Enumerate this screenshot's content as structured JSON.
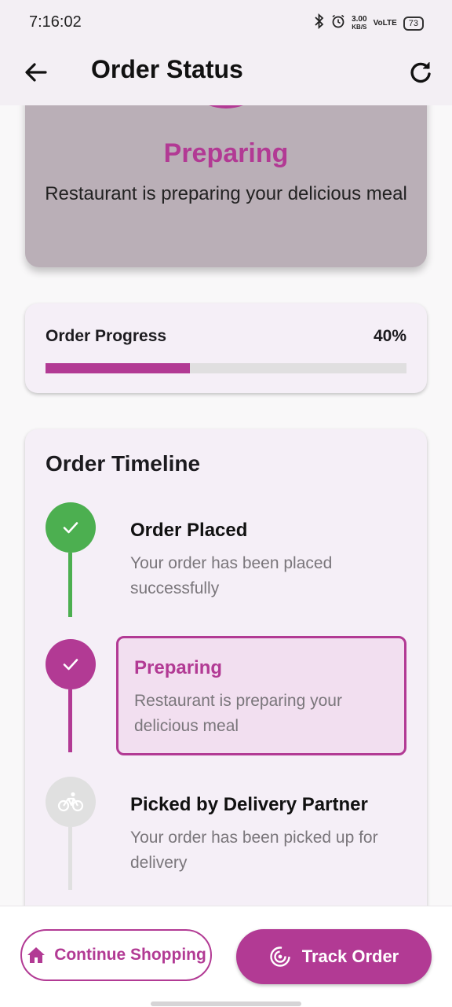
{
  "status_bar": {
    "time": "7:16:02",
    "speed_value": "3.00",
    "speed_unit": "KB/S",
    "network": "VoLTE",
    "battery": "73"
  },
  "app_bar": {
    "title": "Order Status"
  },
  "status_card": {
    "title": "Preparing",
    "description": "Restaurant is preparing your delicious meal",
    "accent_color": "#b23a94"
  },
  "progress": {
    "label": "Order Progress",
    "value_text": "40%",
    "value": 0.4
  },
  "timeline": {
    "title": "Order Timeline",
    "steps": [
      {
        "title": "Order Placed",
        "description": "Your order has been placed successfully",
        "state": "completed",
        "icon": "check-icon",
        "color": "#4caf50"
      },
      {
        "title": "Preparing",
        "description": "Restaurant is preparing your delicious meal",
        "state": "current",
        "icon": "check-icon",
        "color": "#b23a94"
      },
      {
        "title": "Picked by Delivery Partner",
        "description": "Your order has been picked up for delivery",
        "state": "pending",
        "icon": "bicycle-icon",
        "color": "#e0e0e0"
      }
    ]
  },
  "actions": {
    "continue_label": "Continue Shopping",
    "track_label": "Track Order"
  }
}
